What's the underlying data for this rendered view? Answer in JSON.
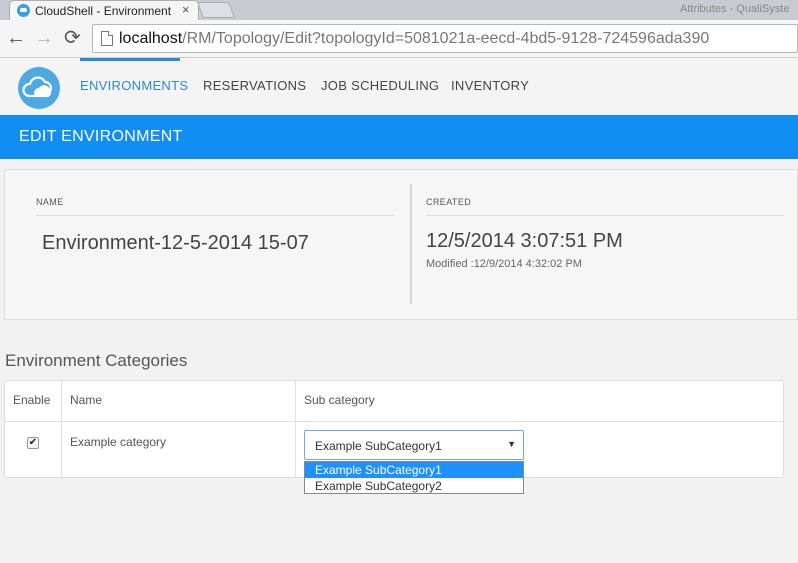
{
  "browser": {
    "tab_title": "CloudShell - Environment",
    "tab_close": "×",
    "window_title": "Attributes - QualiSyste",
    "nav": {
      "back": "←",
      "forward": "→",
      "reload": "⟳"
    },
    "url_host": "localhost",
    "url_path": "/RM/Topology/Edit?topologyId=5081021a-eecd-4bd5-9128-724596ada390"
  },
  "app": {
    "nav_items": [
      "ENVIRONMENTS",
      "RESERVATIONS",
      "JOB SCHEDULING",
      "INVENTORY"
    ],
    "active_nav": "ENVIRONMENTS",
    "accent_color": "#118ef2"
  },
  "page": {
    "title": "EDIT ENVIRONMENT",
    "name_label": "NAME",
    "name_value": "Environment-12-5-2014 15-07",
    "created_label": "CREATED",
    "created_value": "12/5/2014 3:07:51 PM",
    "modified_value": "Modified :12/9/2014 4:32:02 PM"
  },
  "categories": {
    "title": "Environment Categories",
    "headers": {
      "enable": "Enable",
      "name": "Name",
      "sub_category": "Sub category"
    },
    "rows": [
      {
        "enabled": true,
        "checkmark": "✔",
        "name": "Example category",
        "sub_category": "Example SubCategory1"
      }
    ],
    "dropdown": {
      "arrow": "▼",
      "options": [
        "Example SubCategory1",
        "Example SubCategory2"
      ],
      "highlighted": "Example SubCategory1"
    }
  }
}
